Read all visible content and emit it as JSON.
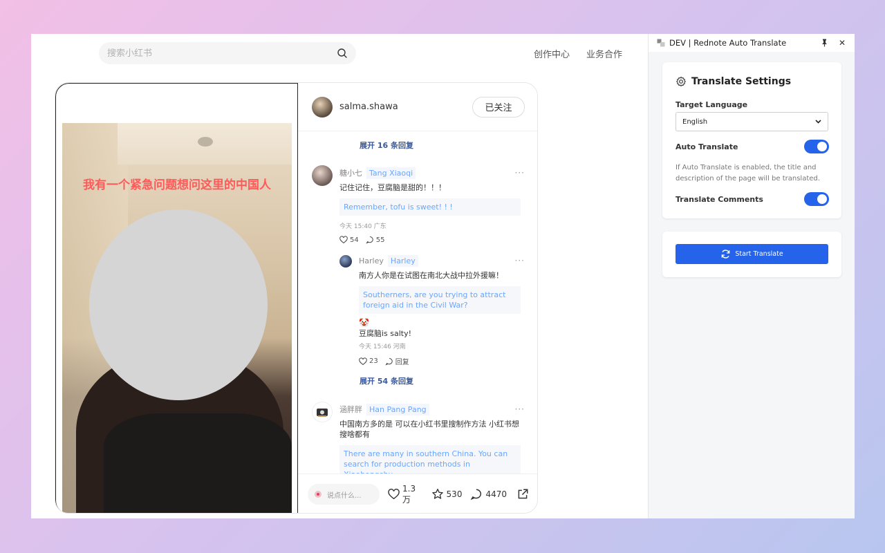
{
  "header": {
    "search_placeholder": "搜索小红书",
    "nav": [
      "创作中心",
      "业务合作"
    ]
  },
  "note": {
    "caption": "我有一个紧急问题想问这里的中国人",
    "author": "salma.shawa",
    "follow_label": "已关注",
    "expand_top": "展开 16 条回复",
    "comments": [
      {
        "name": "糖小七",
        "name_tr": "Tang Xiaoqi",
        "text": "记住记住，豆腐脑是甜的！！！",
        "translation": "Remember, tofu is sweet! ! !",
        "meta": "今天 15:40 广东",
        "likes": "54",
        "replies": "55",
        "reply": {
          "name": "Harley",
          "name_tr": "Harley",
          "text": "南方人你是在试图在南北大战中拉外援嘛！",
          "translation": "Southerners, are you trying to attract foreign aid in the Civil War?",
          "extra_emoji": "🤡",
          "extra_text": "豆腐脑is salty!",
          "meta": "今天 15:46 河南",
          "likes": "23",
          "reply_label": "回复"
        },
        "expand": "展开 54 条回复"
      },
      {
        "name": "涵胖胖",
        "name_tr": "Han Pang Pang",
        "text": "中国南方多的是 可以在小红书里搜制作方法 小红书想搜啥都有",
        "translation": "There are many in southern China. You can search for production methods in Xiaohongshu."
      }
    ],
    "more_glyph": "···",
    "bottom": {
      "say_placeholder": "说点什么...",
      "likes": "1.3万",
      "stars": "530",
      "comments": "4470"
    }
  },
  "extension": {
    "title": "DEV | Rednote Auto Translate",
    "pin_glyph": "📌",
    "close_glyph": "✕",
    "card_title": "Translate Settings",
    "target_language_label": "Target Language",
    "target_language_value": "English",
    "auto_translate_label": "Auto Translate",
    "auto_translate_on": true,
    "help_text": "If Auto Translate is enabled, the title and description of the page will be translated.",
    "translate_comments_label": "Translate Comments",
    "translate_comments_on": true,
    "start_label": "Start Translate",
    "accent": "#2563eb"
  }
}
